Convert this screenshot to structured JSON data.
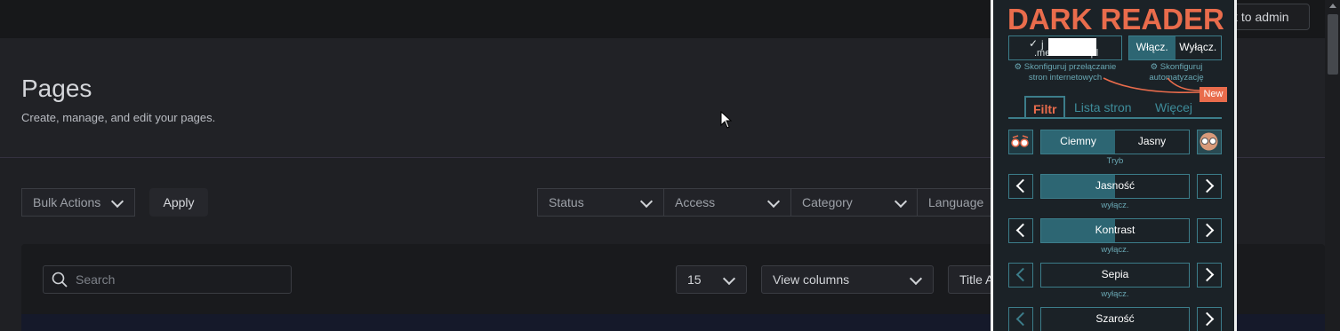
{
  "topbar": {
    "back_label": "k to admin"
  },
  "page": {
    "title": "Pages",
    "subtitle": "Create, manage, and edit your pages."
  },
  "toolbar": {
    "bulk_actions": "Bulk Actions",
    "apply": "Apply",
    "filters": [
      "Status",
      "Access",
      "Category",
      "Language"
    ]
  },
  "table_controls": {
    "search_placeholder": "Search",
    "per_page": "15",
    "view_columns": "View columns",
    "sort": "Title A"
  },
  "dark_reader": {
    "title": "DARK READER",
    "site_line1": "j",
    "site_line2": ".mediamarkt.pl",
    "on_label": "Włącz.",
    "off_label": "Wyłącz.",
    "config_sites": "⚙ Skonfiguruj przełączanie\nstron internetowych",
    "config_auto": "⚙ Skonfiguruj\nautomatyzację",
    "new_badge": "New",
    "tabs": [
      "Filtr",
      "Lista stron",
      "Więcej"
    ],
    "mode": {
      "dark": "Ciemny",
      "light": "Jasny",
      "label": "Tryb"
    },
    "sliders": [
      {
        "name": "Jasność",
        "status": "wyłącz.",
        "value_fraction": 0.5
      },
      {
        "name": "Kontrast",
        "status": "wyłącz.",
        "value_fraction": 0.5
      },
      {
        "name": "Sepia",
        "status": "wyłącz.",
        "value_fraction": 0
      },
      {
        "name": "Szarość",
        "status": "",
        "value_fraction": 0
      }
    ],
    "colors": {
      "accent": "#e96c4c",
      "teal": "#3c7d8a",
      "background": "#1b2227"
    }
  }
}
